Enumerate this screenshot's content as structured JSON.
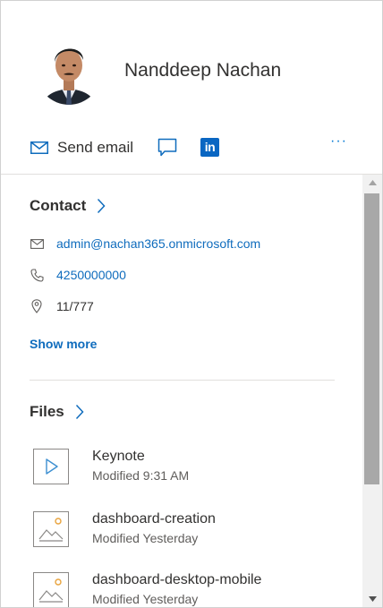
{
  "person": {
    "name": "Nanddeep Nachan"
  },
  "actions": {
    "send_email_label": "Send email",
    "linkedin_label": "in",
    "more_label": "···"
  },
  "contact": {
    "title": "Contact",
    "email": "admin@nachan365.onmicrosoft.com",
    "phone": "4250000000",
    "location": "11/777",
    "show_more": "Show more"
  },
  "files": {
    "title": "Files",
    "items": [
      {
        "name": "Keynote",
        "meta": "Modified 9:31 AM",
        "icon": "video-file-icon"
      },
      {
        "name": "dashboard-creation",
        "meta": "Modified Yesterday",
        "icon": "image-file-icon"
      },
      {
        "name": "dashboard-desktop-mobile",
        "meta": "Modified Yesterday",
        "icon": "image-file-icon"
      }
    ]
  },
  "colors": {
    "accent": "#0f6cbd",
    "linkedin": "#0a66c2",
    "scroll_thumb": "#a8a8a8",
    "thumb_orange": "#e8a33d"
  }
}
